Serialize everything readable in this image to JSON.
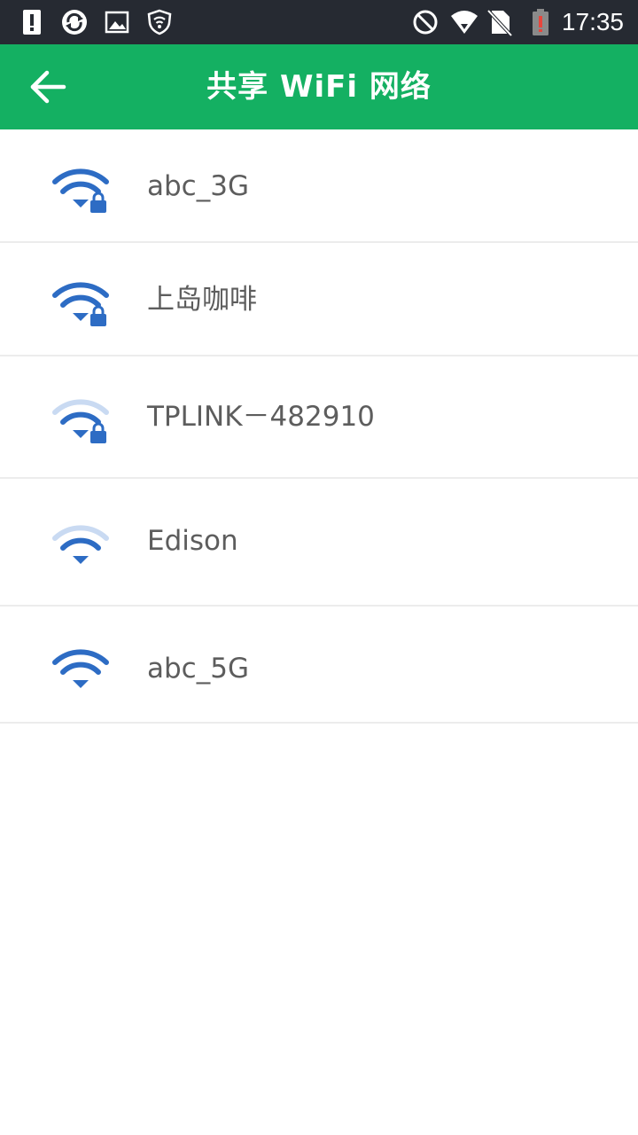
{
  "status_bar": {
    "time": "17:35",
    "left_icons": [
      "alert-icon",
      "sync-icon",
      "image-icon",
      "shield-icon"
    ],
    "right_icons": [
      "do-not-disturb-icon",
      "wifi-signal-icon",
      "no-sim-icon",
      "battery-low-icon"
    ]
  },
  "app_bar": {
    "title": "共享 WiFi 网络",
    "back_icon": "arrow-left-icon",
    "background": "#14b062"
  },
  "networks": [
    {
      "ssid": "abc_3G",
      "signal": "full",
      "locked": true
    },
    {
      "ssid": "上岛咖啡",
      "signal": "full",
      "locked": true
    },
    {
      "ssid": "TPLINK－482910",
      "signal": "weak",
      "locked": true
    },
    {
      "ssid": "Edison",
      "signal": "weak",
      "locked": false
    },
    {
      "ssid": "abc_5G",
      "signal": "full",
      "locked": false
    }
  ],
  "colors": {
    "wifi_strong": "#2d6cc4",
    "wifi_faint": "#c9daf2",
    "text": "#5d5d5d",
    "divider": "#ececec"
  }
}
